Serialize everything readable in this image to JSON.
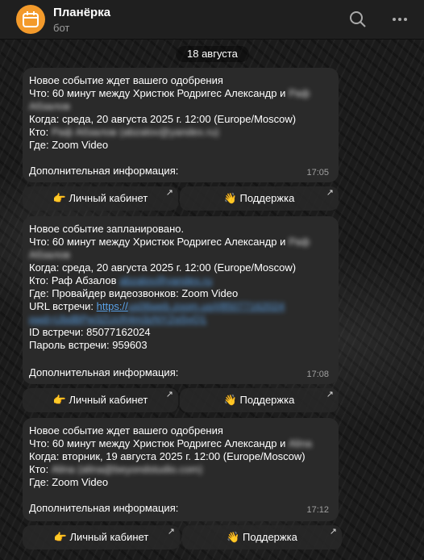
{
  "header": {
    "title": "Планёрка",
    "subtitle": "бот"
  },
  "date_chip": "18 августа",
  "messages": [
    {
      "l1": "Новое событие ждет вашего одобрения",
      "l2": "Что: 60 минут между Христюк Родригес Александр  и",
      "l2_blur": "Раф",
      "l3_blur": "Абзалов",
      "l4": "Когда: среда, 20 августа 2025 г. 12:00 (Europe/Moscow)",
      "l5_label": "Кто:",
      "l5_blur": "Раф Абзалов  (abzalov@yandex.ru)",
      "l6": "Где: Zoom Video",
      "extra": "Дополнительная информация:",
      "time": "17:05"
    },
    {
      "l1": "Новое событие запланировано.",
      "l2": "Что: 60 минут между Христюк Родригес Александр  и",
      "l2_blur": "Раф",
      "l3_blur": "Абзалов",
      "l4": "Когда: среда, 20 августа 2025 г. 12:00 (Europe/Moscow)",
      "l5": "Кто: Раф Абзалов",
      "l5_blur": "abzalov@yandex.ru",
      "l6": "Где: Провайдер видеозвонков: Zoom Video",
      "l7_label": "URL встречи:",
      "l7_link": "https://",
      "l7_blur": "us06web.zoom.us/j/85077162024",
      "l8_blur": "pwd=UbdBPw3ZUcR4m3zNYZgSyQ1",
      "l9": "ID встречи: 85077162024",
      "l10": "Пароль встречи: 959603",
      "extra": "Дополнительная информация:",
      "time": "17:08"
    },
    {
      "l1": "Новое событие ждет вашего одобрения",
      "l2": "Что: 60 минут между Христюк Родригес Александр  и",
      "l2_blur": "Alina",
      "l3": "Когда: вторник, 19 августа 2025 г. 12:00 (Europe/Moscow)",
      "l4_label": "Кто:",
      "l4_blur": "Alina (alina@beyondstudio.com)",
      "l5": "Где: Zoom Video",
      "extra": "Дополнительная информация:",
      "time": "17:12"
    }
  ],
  "buttons": {
    "cabinet": "👉 Личный кабинет",
    "support": "👋 Поддержка",
    "arrow": "↗"
  }
}
